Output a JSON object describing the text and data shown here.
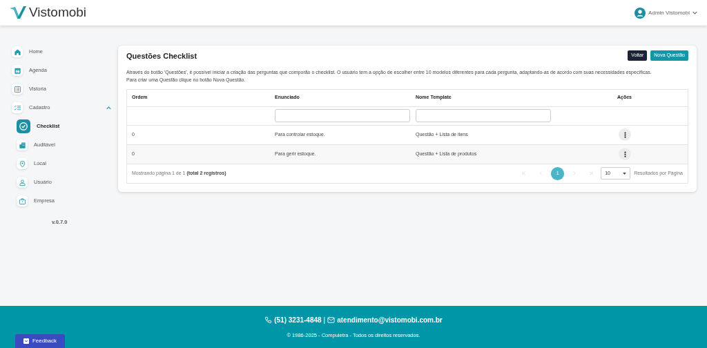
{
  "header": {
    "brand": "Vistomobi",
    "user": "Admin Vistomobi"
  },
  "sidebar": {
    "items": [
      {
        "label": "Home",
        "selected": false
      },
      {
        "label": "Agenda",
        "selected": false
      },
      {
        "label": "Vistoria",
        "selected": false
      },
      {
        "label": "Cadastro",
        "selected": false,
        "expanded": true,
        "children": [
          {
            "label": "Checklist",
            "selected": true
          },
          {
            "label": "Auditável",
            "selected": false
          },
          {
            "label": "Local",
            "selected": false
          },
          {
            "label": "Usuário",
            "selected": false
          },
          {
            "label": "Empresa",
            "selected": false
          }
        ]
      }
    ],
    "version": "v.0.7.0"
  },
  "card": {
    "title": "Questões Checklist",
    "buttons": [
      {
        "label": "Voltar",
        "kind": "dark"
      },
      {
        "label": "Nova Questão",
        "kind": "primary"
      }
    ],
    "description": [
      "Através do botão 'Questões', é possível iniciar a criação das perguntas que comporão o checklist. O usuário tem a opção de escolher entre 10 modelos diferentes para cada pergunta, adaptando-as de acordo com suas necessidades específicas.",
      "Para criar uma Questão clique no botão Nova Questão."
    ]
  },
  "table": {
    "columns": [
      "Ordem",
      "Enunciado",
      "Nome Template",
      "Ações"
    ],
    "rows": [
      {
        "ordem": "0",
        "enunciado": "Para controlar estoque.",
        "template": "Questão + Lista de itens"
      },
      {
        "ordem": "0",
        "enunciado": "Para gerir estoque.",
        "template": "Questão + Lista de produtos"
      }
    ],
    "summary": "Mostrando página 1 de 1 **(total 2 registros)**",
    "pages": [
      {
        "label": "1",
        "selected": true
      }
    ],
    "page_size": "10",
    "page_size_label": "Resultados por Página"
  },
  "footer": {
    "phone": "(51) 3231-4848",
    "separator": "|",
    "email": "atendimento@vistomobi.com.br",
    "copyright": "© 1986-2025 - Compuletra - Todos os direitos reservados."
  },
  "feedback": "Feedback"
}
